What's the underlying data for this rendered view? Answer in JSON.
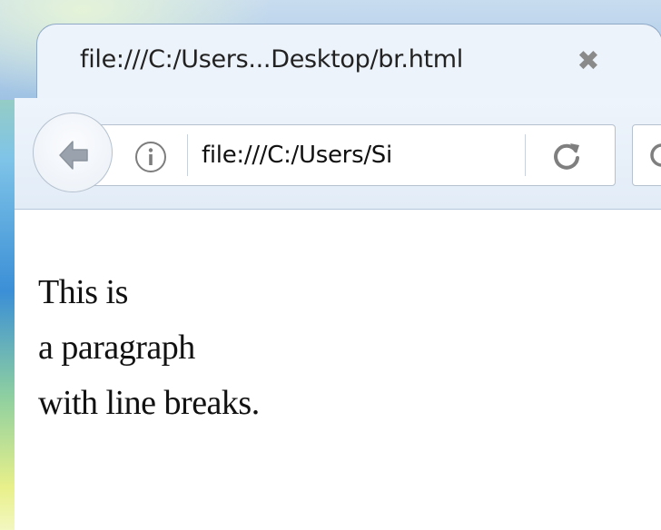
{
  "tab": {
    "title": "file:///C:/Users...Desktop/br.html",
    "close_glyph": "✖"
  },
  "toolbar": {
    "back_icon": "back-arrow-icon",
    "info_icon": "info-icon",
    "url": "file:///C:/Users/Si",
    "reload_icon": "reload-icon",
    "search_icon": "search-icon"
  },
  "page": {
    "lines": [
      "This is",
      "a paragraph",
      "with line breaks."
    ]
  },
  "colors": {
    "chrome_light": "#edf3fb",
    "chrome_blue": "#9fc2e4",
    "icon_gray": "#8a8a8a",
    "text": "#111111"
  }
}
